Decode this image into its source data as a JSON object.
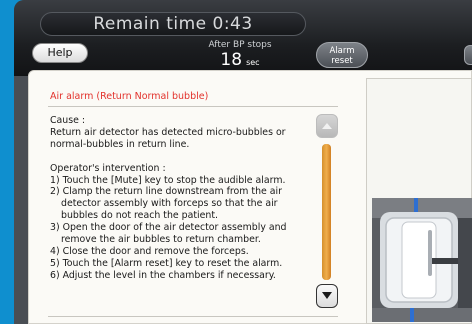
{
  "header": {
    "remain_time": "Remain time 0:43",
    "help_label": "Help",
    "bp_label": "After BP stops",
    "bp_value": "18",
    "bp_unit": "sec",
    "alarm_reset_line1": "Alarm",
    "alarm_reset_line2": "reset"
  },
  "alarm": {
    "title": "Air alarm (Return Normal bubble)",
    "cause_heading": "Cause :",
    "cause_lines": [
      "Return air detector has detected micro-bubbles or",
      "normal-bubbles in return line."
    ],
    "intervention_heading": "Operator's intervention :",
    "steps": [
      {
        "line": "1) Touch the [Mute] key to stop the audible alarm.",
        "cont": []
      },
      {
        "line": "2) Clamp the return line downstream from the air",
        "cont": [
          "detector assembly with forceps so that the air",
          "bubbles do not reach the patient."
        ]
      },
      {
        "line": "3) Open the door of the air detector assembly and",
        "cont": [
          "remove the air bubbles to return chamber."
        ]
      },
      {
        "line": "4) Close the door and remove the forceps.",
        "cont": []
      },
      {
        "line": "5) Touch the [Alarm reset] key to reset the alarm.",
        "cont": []
      },
      {
        "line": "6) Adjust the level in the chambers if necessary.",
        "cont": []
      }
    ]
  },
  "scroll": {
    "up_enabled": false,
    "down_enabled": true
  },
  "colors": {
    "background": "#0f8fcf",
    "title_red": "#e2322c",
    "scroll_thumb": "#f0ae4c"
  }
}
